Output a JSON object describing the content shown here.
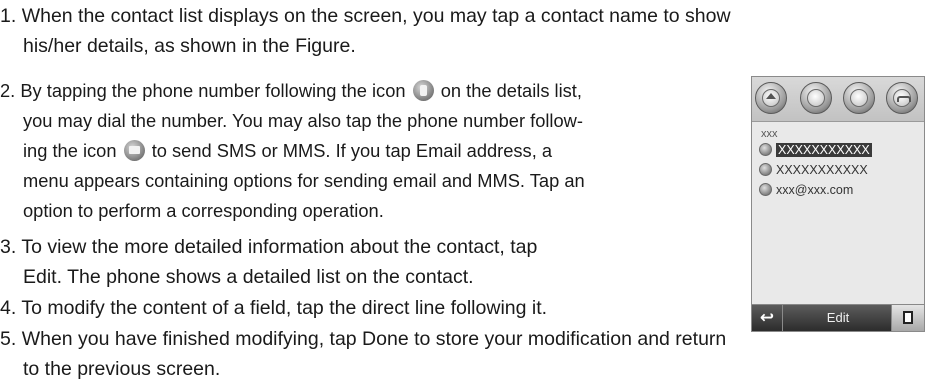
{
  "steps": [
    {
      "number": "1.",
      "lines": [
        "When the contact list displays on the screen, you may tap a contact name to show",
        "his/her details, as shown in the Figure."
      ]
    },
    {
      "number": "2.",
      "line1_pre": "By tapping the phone number following the icon",
      "line1_post": "on the details list,",
      "line2": "you may dial the number. You may also tap the phone number follow-",
      "line3_pre": "ing the icon",
      "line3_post": "to send SMS or MMS. If you tap Email address, a",
      "line4": "menu appears containing options for sending email and MMS. Tap an",
      "line5": "option to perform a corresponding operation."
    },
    {
      "number": "3.",
      "lines": [
        "To view the more detailed information about the contact, tap",
        "Edit. The phone shows a detailed list on the contact."
      ]
    },
    {
      "number": "4.",
      "lines": [
        "To modify the content of a field, tap the direct line following it."
      ]
    },
    {
      "number": "5.",
      "lines": [
        "When you have finished modifying, tap Done to store your modification and return",
        "to the previous screen."
      ]
    }
  ],
  "phone": {
    "contact_name": "xxx",
    "phone_number": "XXXXXXXXXXX",
    "sms_number": "XXXXXXXXXXX",
    "email": "xxx@xxx.com",
    "edit_label": "Edit",
    "back_glyph": "↩"
  },
  "icons": {
    "phone_icon": "phone-icon",
    "sms_icon": "sms-icon",
    "email_icon": "email-icon"
  }
}
